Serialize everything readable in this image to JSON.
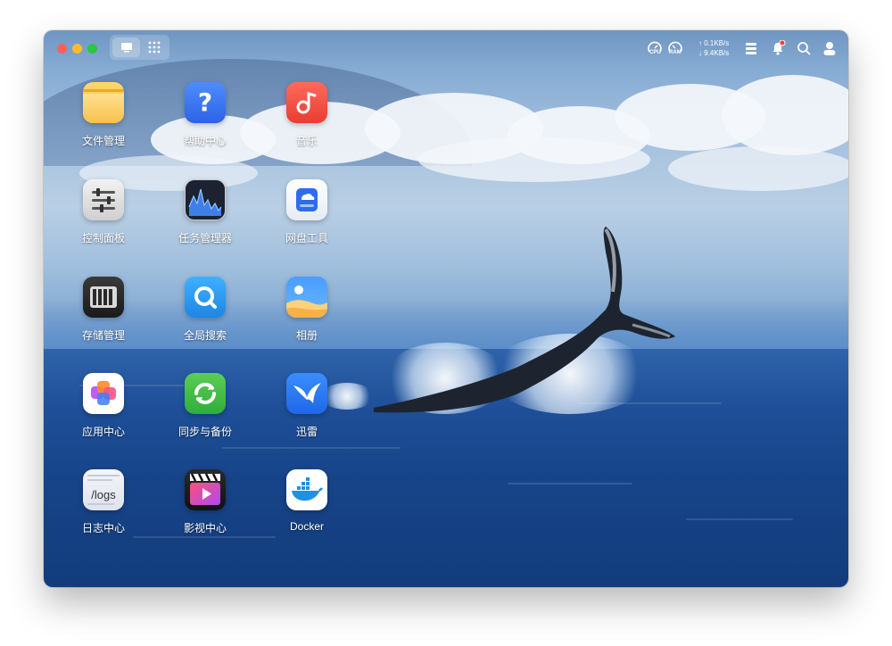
{
  "topbar": {
    "cpu_label": "CPU",
    "ram_label": "RAM",
    "upload_speed": "0.1KB/s",
    "download_speed": "9.4KB/s",
    "colors": {
      "close": "#fe5f57",
      "minimize": "#febc2e",
      "maximize": "#28c840",
      "notification_dot": "#ff3b30"
    }
  },
  "apps": [
    {
      "label": "文件管理"
    },
    {
      "label": "帮助中心"
    },
    {
      "label": "音乐"
    },
    {
      "label": "控制面板"
    },
    {
      "label": "任务管理器"
    },
    {
      "label": "网盘工具"
    },
    {
      "label": "存储管理"
    },
    {
      "label": "全局搜索"
    },
    {
      "label": "相册"
    },
    {
      "label": "应用中心"
    },
    {
      "label": "同步与备份"
    },
    {
      "label": "迅雷"
    },
    {
      "label": "日志中心",
      "tile_text": "/logs"
    },
    {
      "label": "影视中心"
    },
    {
      "label": "Docker"
    }
  ]
}
